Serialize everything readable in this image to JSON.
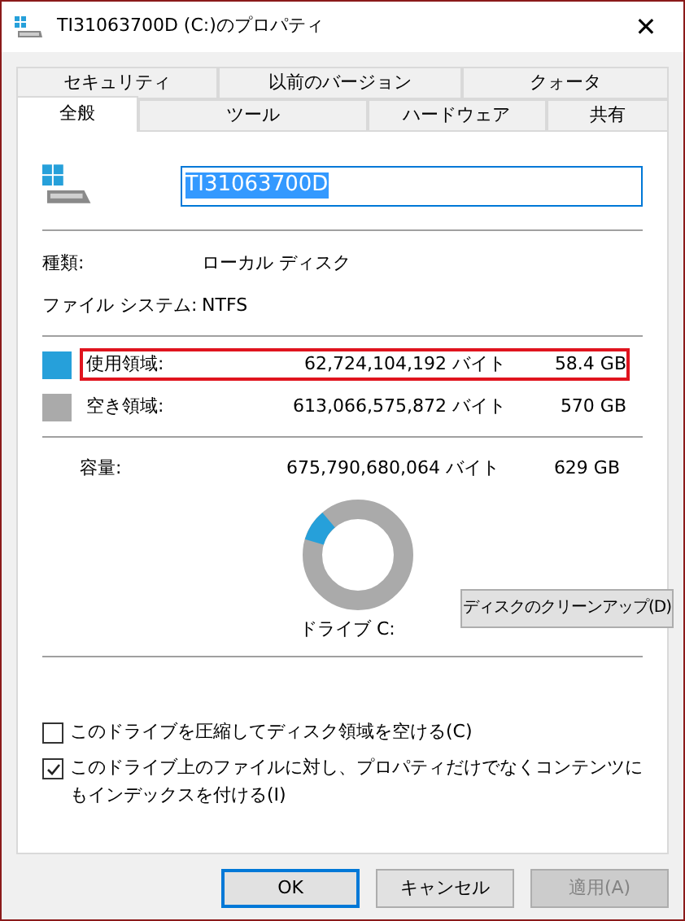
{
  "window": {
    "title": "TI31063700D (C:)のプロパティ",
    "close": "✕"
  },
  "tabs_back": [
    {
      "label": "セキュリティ",
      "selected": false
    },
    {
      "label": "以前のバージョン",
      "selected": false
    },
    {
      "label": "クォータ",
      "selected": false
    }
  ],
  "tabs_front": [
    {
      "label": "全般",
      "selected": true
    },
    {
      "label": "ツール",
      "selected": false
    },
    {
      "label": "ハードウェア",
      "selected": false
    },
    {
      "label": "共有",
      "selected": false
    }
  ],
  "name_field": {
    "value": "TI31063700D"
  },
  "info": [
    {
      "label": "種類:",
      "value": "ローカル ディスク"
    },
    {
      "label": "ファイル システム:",
      "value": "NTFS"
    }
  ],
  "space": [
    {
      "label": "使用領域:",
      "bytes": "62,724,104,192 バイト",
      "size": "58.4 GB",
      "color": "#26a0da",
      "highlighted": true
    },
    {
      "label": "空き領域:",
      "bytes": "613,066,575,872 バイト",
      "size": "570 GB",
      "color": "#aaaaaa",
      "highlighted": false
    }
  ],
  "capacity": {
    "label": "容量:",
    "bytes": "675,790,680,064 バイト",
    "size": "629 GB"
  },
  "usage": {
    "level": 0.093,
    "drive_label": "ドライブ C:"
  },
  "cleanup_button": "ディスクのクリーンアップ(D)",
  "options": [
    {
      "label": "このドライブを圧縮してディスク領域を空ける(C)",
      "checked": false
    },
    {
      "label": "このドライブ上のファイルに対し、プロパティだけでなくコンテンツにもインデックスを付ける(I)",
      "checked": true
    }
  ],
  "buttons": [
    {
      "label": "OK",
      "default": true,
      "disabled": false
    },
    {
      "label": "キャンセル",
      "default": false,
      "disabled": false
    },
    {
      "label": "適用(A)",
      "default": false,
      "disabled": true
    }
  ]
}
